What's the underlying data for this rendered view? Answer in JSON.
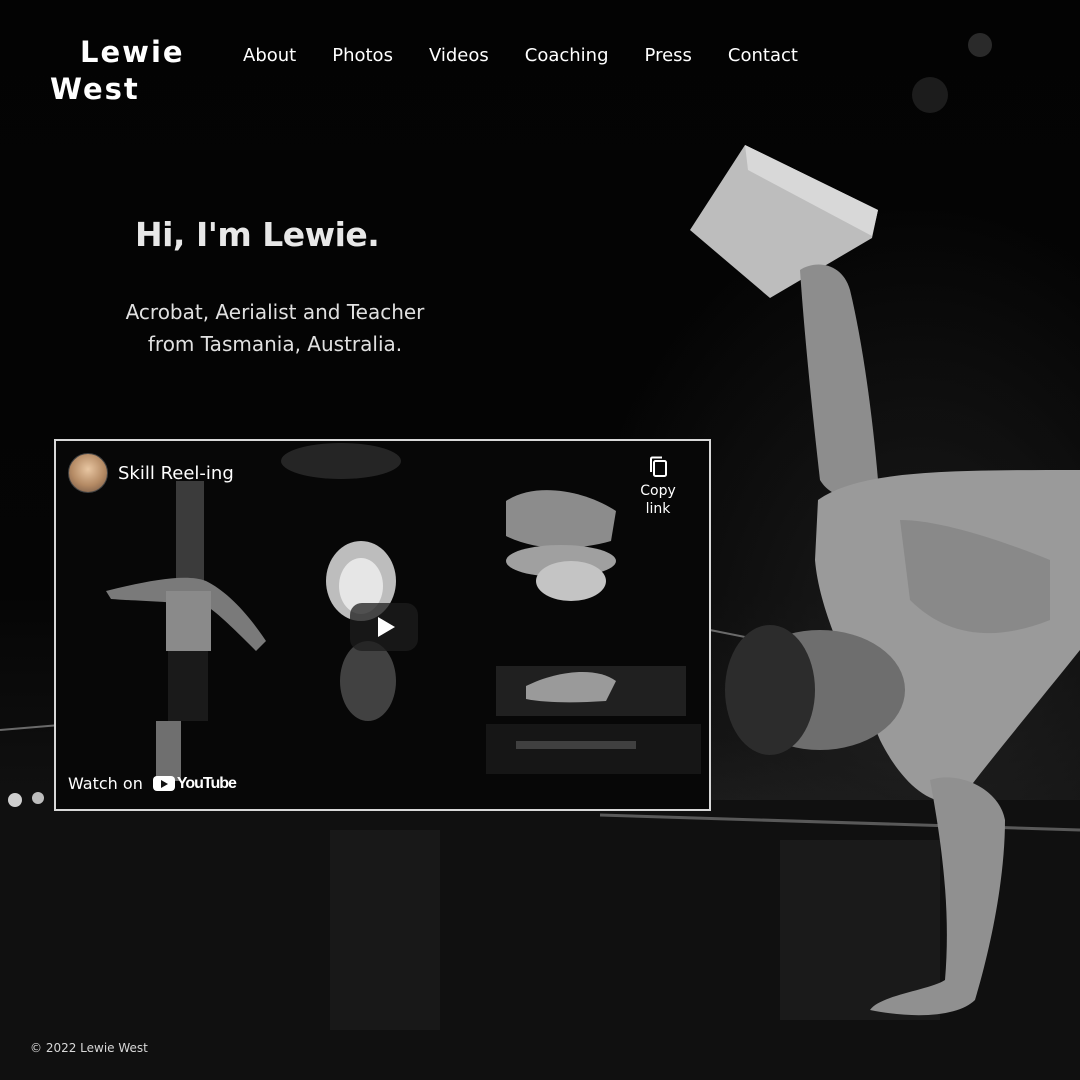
{
  "site": {
    "logo_line1": "Lewie",
    "logo_line2": "West"
  },
  "nav": {
    "items": [
      {
        "label": "About"
      },
      {
        "label": "Photos"
      },
      {
        "label": "Videos"
      },
      {
        "label": "Coaching"
      },
      {
        "label": "Press"
      },
      {
        "label": "Contact"
      }
    ]
  },
  "hero": {
    "title": "Hi, I'm Lewie.",
    "subtitle_line1": "Acrobat, Aerialist and Teacher",
    "subtitle_line2": "from Tasmania, Australia."
  },
  "video": {
    "title": "Skill Reel-ing",
    "copy_link_label": "Copy link",
    "watch_on_label": "Watch on",
    "platform_label": "YouTube"
  },
  "footer": {
    "copyright": "© 2022 Lewie West"
  },
  "icons": {
    "play": "play-icon",
    "copy": "copy-icon",
    "youtube": "youtube-logo-icon"
  }
}
